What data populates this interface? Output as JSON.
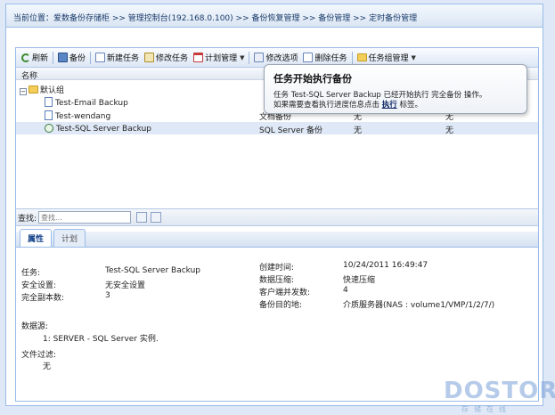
{
  "breadcrumb": "当前位置：爱数备份存储柜 >> 管理控制台(192.168.0.100) >> 备份恢复管理 >> 备份管理 >> 定时备份管理",
  "toolbar": {
    "refresh": "刷新",
    "backup": "备份",
    "new_task": "新建任务",
    "edit_task": "修改任务",
    "schedule": "计划管理",
    "edit_options": "修改选项",
    "delete_task": "删除任务",
    "task_group": "任务组管理"
  },
  "grid": {
    "header_name": "名称",
    "group": "默认组",
    "rows": [
      {
        "name": "Test-Email Backup",
        "type": "",
        "s1": "",
        "s2": ""
      },
      {
        "name": "Test-wendang",
        "type": "文档备份",
        "s1": "无",
        "s2": "无"
      },
      {
        "name": "Test-SQL Server Backup",
        "type": "SQL Server 备份",
        "s1": "无",
        "s2": "无"
      }
    ]
  },
  "popup": {
    "title": "任务开始执行备份",
    "line1": "任务  Test-SQL Server Backup 已经开始执行  完全备份  操作。",
    "line2_pre": "如果需要查看执行进度信息点击",
    "link": "执行",
    "line2_post": "标签。"
  },
  "search": {
    "label": "查找:",
    "placeholder": "查找..."
  },
  "tabs": [
    "属性",
    "计划"
  ],
  "props": {
    "task_label": "任务:",
    "task_value": "Test-SQL Server Backup",
    "security_label": "安全设置:",
    "security_value": "无安全设置",
    "copies_label": "完全副本数:",
    "copies_value": "3",
    "created_label": "创建时间:",
    "created_value": "10/24/2011 16:49:47",
    "compress_label": "数据压缩:",
    "compress_value": "快速压缩",
    "clients_label": "客户端并发数:",
    "clients_value": "4",
    "dest_label": "备份目的地:",
    "dest_value": "介质服务器(NAS : volume1/VMP/1/2/7/)",
    "source_label": "数据源:",
    "source_value": "1: SERVER - SQL Server 实例.",
    "filter_label": "文件过滤:",
    "filter_value": "无"
  },
  "watermark": {
    "brand": "DOSTOR",
    "sub": "存储在线"
  }
}
